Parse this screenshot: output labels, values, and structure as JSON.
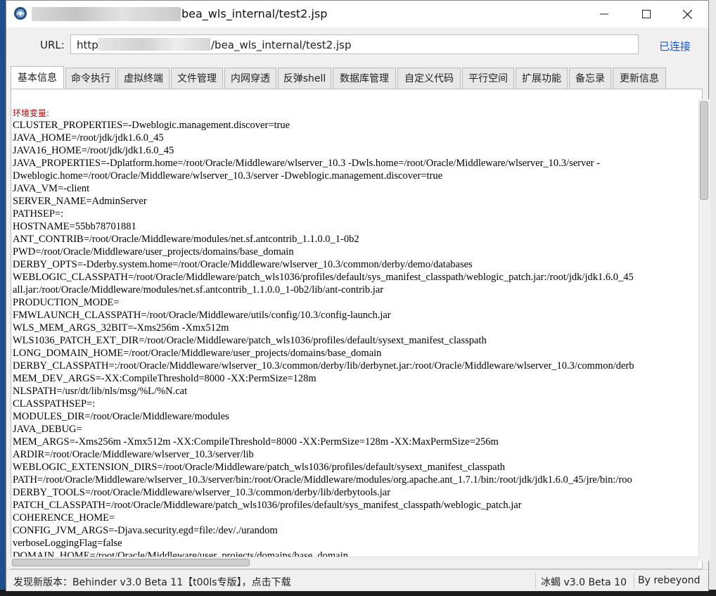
{
  "window": {
    "title_prefix": "h",
    "title": "bea_wls_internal/test2.jsp"
  },
  "url_bar": {
    "label": "URL:",
    "value_prefix": "http",
    "value_suffix": "/bea_wls_internal/test2.jsp",
    "status": "已连接"
  },
  "tabs": [
    {
      "label": "基本信息",
      "active": true
    },
    {
      "label": "命令执行"
    },
    {
      "label": "虚拟终端"
    },
    {
      "label": "文件管理"
    },
    {
      "label": "内网穿透"
    },
    {
      "label": "反弹shell"
    },
    {
      "label": "数据库管理"
    },
    {
      "label": "自定义代码"
    },
    {
      "label": "平行空间"
    },
    {
      "label": "扩展功能"
    },
    {
      "label": "备忘录"
    },
    {
      "label": "更新信息"
    }
  ],
  "content": {
    "heading": "环境变量:",
    "lines": [
      "CLUSTER_PROPERTIES=-Dweblogic.management.discover=true",
      "JAVA_HOME=/root/jdk/jdk1.6.0_45",
      "JAVA16_HOME=/root/jdk/jdk1.6.0_45",
      "JAVA_PROPERTIES=-Dplatform.home=/root/Oracle/Middleware/wlserver_10.3 -Dwls.home=/root/Oracle/Middleware/wlserver_10.3/server -",
      "Dweblogic.home=/root/Oracle/Middleware/wlserver_10.3/server -Dweblogic.management.discover=true",
      "JAVA_VM=-client",
      "SERVER_NAME=AdminServer",
      "PATHSEP=:",
      "HOSTNAME=55bb78701881",
      "ANT_CONTRIB=/root/Oracle/Middleware/modules/net.sf.antcontrib_1.1.0.0_1-0b2",
      "PWD=/root/Oracle/Middleware/user_projects/domains/base_domain",
      "DERBY_OPTS=-Dderby.system.home=/root/Oracle/Middleware/wlserver_10.3/common/derby/demo/databases",
      "WEBLOGIC_CLASSPATH=/root/Oracle/Middleware/patch_wls1036/profiles/default/sys_manifest_classpath/weblogic_patch.jar:/root/jdk/jdk1.6.0_45",
      "all.jar:/root/Oracle/Middleware/modules/net.sf.antcontrib_1.1.0.0_1-0b2/lib/ant-contrib.jar",
      "PRODUCTION_MODE=",
      "FMWLAUNCH_CLASSPATH=/root/Oracle/Middleware/utils/config/10.3/config-launch.jar",
      "WLS_MEM_ARGS_32BIT=-Xms256m -Xmx512m",
      "WLS1036_PATCH_EXT_DIR=/root/Oracle/Middleware/patch_wls1036/profiles/default/sysext_manifest_classpath",
      "LONG_DOMAIN_HOME=/root/Oracle/Middleware/user_projects/domains/base_domain",
      "DERBY_CLASSPATH=:/root/Oracle/Middleware/wlserver_10.3/common/derby/lib/derbynet.jar:/root/Oracle/Middleware/wlserver_10.3/common/derb",
      "MEM_DEV_ARGS=-XX:CompileThreshold=8000 -XX:PermSize=128m",
      "NLSPATH=/usr/dt/lib/nls/msg/%L/%N.cat",
      "CLASSPATHSEP=:",
      "MODULES_DIR=/root/Oracle/Middleware/modules",
      "JAVA_DEBUG=",
      "MEM_ARGS=-Xms256m -Xmx512m -XX:CompileThreshold=8000 -XX:PermSize=128m -XX:MaxPermSize=256m",
      "ARDIR=/root/Oracle/Middleware/wlserver_10.3/server/lib",
      "WEBLOGIC_EXTENSION_DIRS=/root/Oracle/Middleware/patch_wls1036/profiles/default/sysext_manifest_classpath",
      "PATH=/root/Oracle/Middleware/wlserver_10.3/server/bin:/root/Oracle/Middleware/modules/org.apache.ant_1.7.1/bin:/root/jdk/jdk1.6.0_45/jre/bin:/roo",
      "DERBY_TOOLS=/root/Oracle/Middleware/wlserver_10.3/common/derby/lib/derbytools.jar",
      "PATCH_CLASSPATH=/root/Oracle/Middleware/patch_wls1036/profiles/default/sys_manifest_classpath/weblogic_patch.jar",
      "COHERENCE_HOME=",
      "CONFIG_JVM_ARGS=-Djava.security.egd=file:/dev/./urandom",
      "verboseLoggingFlag=false",
      "DOMAIN_HOME=/root/Oracle/Middleware/user_projects/domains/base_domain"
    ]
  },
  "status_bar": {
    "message": "发现新版本：Behinder v3.0 Beta 11【t00ls专版】，点击下载",
    "version": "冰蝎 v3.0 Beta 10",
    "author": "By rebeyond"
  },
  "icons": {
    "app": "behinder-app-icon",
    "minimize": "minimize-icon",
    "maximize": "maximize-icon",
    "close": "close-icon"
  },
  "colors": {
    "link": "#1a56d6",
    "heading": "#c00000"
  }
}
